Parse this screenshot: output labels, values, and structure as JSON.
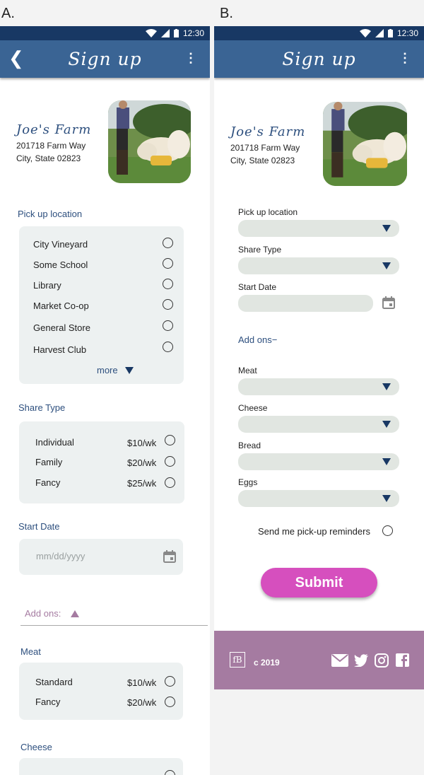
{
  "labels": {
    "a": "A.",
    "b": "B."
  },
  "status": {
    "time": "12:30"
  },
  "appbar": {
    "title": "Sign up"
  },
  "farm": {
    "name": "Joe's Farm",
    "address_line1": "201718 Farm Way",
    "address_line2": "City, State 02823"
  },
  "a": {
    "pickup": {
      "label": "Pick up location",
      "options": [
        "City Vineyard",
        "Some School",
        "Library",
        "Market Co-op",
        "General Store",
        "Harvest Club"
      ],
      "more": "more"
    },
    "share": {
      "label": "Share Type",
      "options": [
        {
          "name": "Individual",
          "price": "$10/wk"
        },
        {
          "name": "Family",
          "price": "$20/wk"
        },
        {
          "name": "Fancy",
          "price": "$25/wk"
        }
      ]
    },
    "start": {
      "label": "Start Date",
      "placeholder": "mm/dd/yyyy"
    },
    "addons": {
      "label": "Add ons:"
    },
    "meat": {
      "label": "Meat",
      "options": [
        {
          "name": "Standard",
          "price": "$10/wk"
        },
        {
          "name": "Fancy",
          "price": "$20/wk"
        }
      ]
    },
    "cheese": {
      "label": "Cheese"
    }
  },
  "b": {
    "pickup_label": "Pick up location",
    "share_label": "Share Type",
    "start_label": "Start Date",
    "addons_label": "Add ons−",
    "meat_label": "Meat",
    "cheese_label": "Cheese",
    "bread_label": "Bread",
    "eggs_label": "Eggs",
    "reminder": "Send me pick-up reminders",
    "submit": "Submit",
    "footer": {
      "logo": "fB",
      "copyright": "c 2019"
    }
  },
  "colors": {
    "statusbar": "#183864",
    "appbar": "#3a6494",
    "accent_text": "#2d4f7e",
    "addons": "#a57ba1",
    "submit": "#d64fbe",
    "footer": "#a57ba1"
  }
}
